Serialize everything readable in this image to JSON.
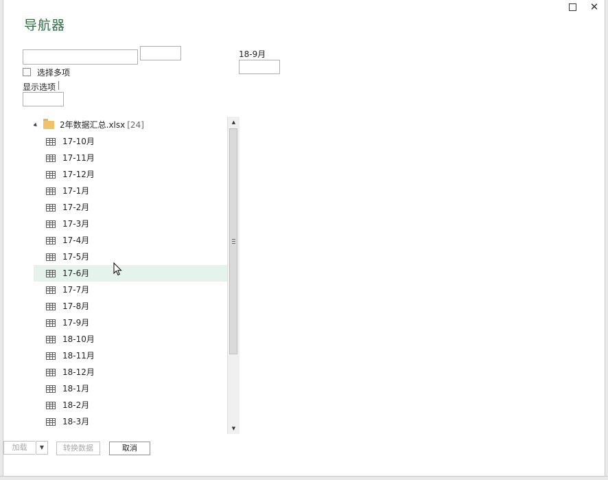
{
  "window": {
    "title": "导航器",
    "maximize_icon": "maximize-icon",
    "close_glyph": "✕"
  },
  "search": {
    "value": "",
    "button_label": ""
  },
  "select_multiple": {
    "label": "选择多项",
    "checked": false
  },
  "display_options": {
    "label": "显示选项"
  },
  "preview": {
    "title": "18-9月"
  },
  "tree": {
    "root": {
      "name": "2年数据汇总.xlsx",
      "count": "[24]",
      "icon": "folder-icon"
    },
    "items": [
      {
        "label": "17-10月"
      },
      {
        "label": "17-11月"
      },
      {
        "label": "17-12月"
      },
      {
        "label": "17-1月"
      },
      {
        "label": "17-2月"
      },
      {
        "label": "17-3月"
      },
      {
        "label": "17-4月"
      },
      {
        "label": "17-5月"
      },
      {
        "label": "17-6月",
        "hovered": true
      },
      {
        "label": "17-7月"
      },
      {
        "label": "17-8月"
      },
      {
        "label": "17-9月"
      },
      {
        "label": "18-10月"
      },
      {
        "label": "18-11月"
      },
      {
        "label": "18-12月"
      },
      {
        "label": "18-1月"
      },
      {
        "label": "18-2月"
      },
      {
        "label": "18-3月"
      }
    ]
  },
  "scrollbar": {
    "up_glyph": "▲",
    "down_glyph": "▼"
  },
  "footer": {
    "load_label": "加载",
    "load_dropdown_glyph": "▼",
    "transform_label": "转换数据",
    "cancel_label": "取消"
  },
  "colors": {
    "title": "#2e6e45",
    "hover_row": "#e6f2ec",
    "folder": "#f0c26a",
    "disabled_text": "#a8a8a8"
  }
}
